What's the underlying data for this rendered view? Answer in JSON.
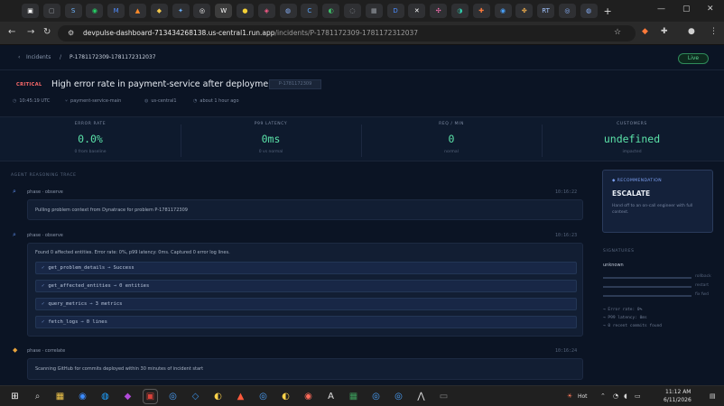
{
  "browser": {
    "tab_icons": [
      {
        "glyph": "▣",
        "color": "#ffffff"
      },
      {
        "glyph": "▢",
        "color": "#9aa0a6"
      },
      {
        "glyph": "S",
        "color": "#6fb6ff"
      },
      {
        "glyph": "◉",
        "color": "#25d366"
      },
      {
        "glyph": "M",
        "color": "#4f8cff"
      },
      {
        "glyph": "▲",
        "color": "#ff8a2a"
      },
      {
        "glyph": "◆",
        "color": "#f3c84b"
      },
      {
        "glyph": "✦",
        "color": "#6db3ff"
      },
      {
        "glyph": "◎",
        "color": "#ffffff"
      },
      {
        "glyph": "W",
        "color": "#ffffff"
      },
      {
        "glyph": "●",
        "color": "#f4d035"
      },
      {
        "glyph": "◈",
        "color": "#ff5b8a"
      },
      {
        "glyph": "◍",
        "color": "#8ab4ff"
      },
      {
        "glyph": "C",
        "color": "#5aa7ff"
      },
      {
        "glyph": "◐",
        "color": "#3fc56b"
      },
      {
        "glyph": "◌",
        "color": "#9aa0a6"
      },
      {
        "glyph": "▦",
        "color": "#9aa0a6"
      },
      {
        "glyph": "D",
        "color": "#4a8cff"
      },
      {
        "glyph": "✕",
        "color": "#ffffff"
      },
      {
        "glyph": "✣",
        "color": "#ff6fb4"
      },
      {
        "glyph": "◑",
        "color": "#31c7a8"
      },
      {
        "glyph": "✚",
        "color": "#ff7a3a"
      },
      {
        "glyph": "◉",
        "color": "#4aa3ff"
      },
      {
        "glyph": "✤",
        "color": "#e9a94b"
      },
      {
        "glyph": "RT",
        "color": "#a0c4ff"
      },
      {
        "glyph": "◎",
        "color": "#8ab4ff"
      },
      {
        "glyph": "◍",
        "color": "#8ab4ff"
      }
    ],
    "new_tab": "+",
    "url_host": "devpulse-dashboard-713434268138.us-central1.run.app",
    "url_path": "/incidents/P-1781172309-1781172312037"
  },
  "app": {
    "breadcrumb_incidents": "Incidents",
    "breadcrumb_sep": "/",
    "breadcrumb_current": "P-1781172309-1781172312037",
    "live": "Live",
    "severity": "CRITICAL",
    "title": "High error rate in payment-service after deployment",
    "id_pill": "P-1781172309",
    "meta": {
      "time": "10:45:19 UTC",
      "service": "payment-service-main",
      "region": "us-central1",
      "age": "about 1 hour ago"
    },
    "metrics": [
      {
        "label": "ERROR RATE",
        "value": "0.0%",
        "sub": "0 from baseline"
      },
      {
        "label": "P99 LATENCY",
        "value": "0ms",
        "sub": "0 vs normal"
      },
      {
        "label": "REQ / MIN",
        "value": "0",
        "sub": "normal"
      },
      {
        "label": "CUSTOMERS",
        "value": "undefined",
        "sub": "impacted"
      }
    ],
    "trace_header": "AGENT REASONING TRACE",
    "steps": [
      {
        "label": "phase · observe",
        "time": "10:16:22",
        "text": "Pulling problem context from Dynatrace for problem P-1781172309"
      },
      {
        "label": "phase · observe",
        "time": "10:16:23",
        "text": "Found 0 affected entities. Error rate: 0%, p99 latency: 0ms. Captured 0 error log lines."
      },
      {
        "label": "phase · correlate",
        "time": "10:16:24",
        "text": "Scanning GitHub for commits deployed within 30 minutes of incident start"
      }
    ],
    "tools": [
      {
        "check": "✓",
        "name": "get_problem_details",
        "arrow": "→",
        "result": "Success"
      },
      {
        "check": "✓",
        "name": "get_affected_entities",
        "arrow": "→",
        "result": "0 entities"
      },
      {
        "check": "✓",
        "name": "query_metrics",
        "arrow": "→",
        "result": "3 metrics"
      },
      {
        "check": "✓",
        "name": "fetch_logs",
        "arrow": "→",
        "result": "0 lines"
      }
    ],
    "recommendation": {
      "header": "◆ RECOMMENDATION",
      "action": "ESCALATE",
      "desc": "Hand off to an on-call engineer with full context."
    },
    "side": {
      "header": "SIGNATURES",
      "value": "unknown",
      "bars": [
        {
          "label": "rollback",
          "level": 0.0
        },
        {
          "label": "restart",
          "level": 0.0
        },
        {
          "label": "fix fwd",
          "level": 0.0
        }
      ],
      "lines": [
        "→ Error rate: 0%",
        "→ P99 latency: 0ms",
        "→ 0 recent commits found"
      ]
    }
  },
  "taskbar": {
    "icons": [
      {
        "color": "#ffffff"
      },
      {
        "color": "#c9c9c9"
      },
      {
        "color": "#f3c84b"
      },
      {
        "color": "#3c8cff"
      },
      {
        "color": "#1ea0ff"
      },
      {
        "color": "#b14ad8"
      },
      {
        "color": "#d9423a"
      },
      {
        "color": "#4aa3ff"
      },
      {
        "color": "#3c91e6"
      },
      {
        "color": "#ffd34a"
      },
      {
        "color": "#ff5a3c"
      },
      {
        "color": "#4aa3ff"
      },
      {
        "color": "#ffd34a"
      },
      {
        "color": "#ff6b5a"
      },
      {
        "color": "#e0e0e0"
      },
      {
        "color": "#3c9b5a"
      },
      {
        "color": "#4aa3ff"
      },
      {
        "color": "#4aa3ff"
      },
      {
        "color": "#e0e0e0"
      },
      {
        "color": "#808080"
      }
    ],
    "weather": "Hot",
    "time": "11:12 AM",
    "date": "6/11/2026"
  }
}
